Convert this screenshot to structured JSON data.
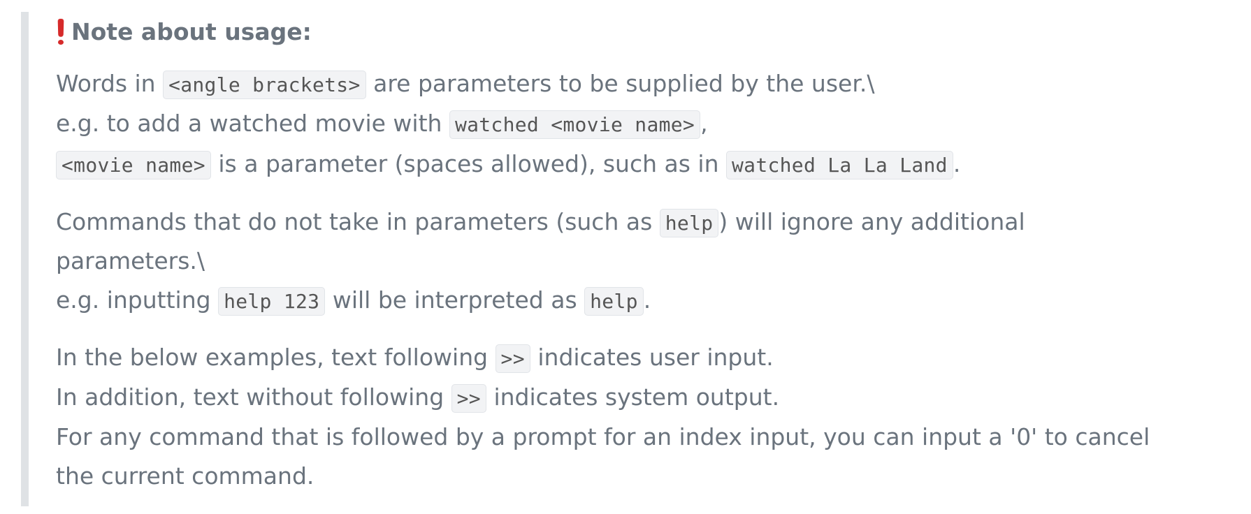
{
  "heading": "Note about usage:",
  "p1": {
    "l1_a": "Words in ",
    "l1_code": "<angle brackets>",
    "l1_b": " are parameters to be supplied by the user.\\",
    "l2_a": "e.g. to add a watched movie with ",
    "l2_code": "watched <movie name>",
    "l2_b": ",",
    "l3_code1": "<movie name>",
    "l3_a": " is a parameter (spaces allowed), such as in ",
    "l3_code2": "watched La La Land",
    "l3_b": "."
  },
  "p2": {
    "l1_a": "Commands that do not take in parameters (such as ",
    "l1_code": "help",
    "l1_b": ") will ignore any additional",
    "l2": "parameters.\\",
    "l3_a": "e.g. inputting ",
    "l3_code1": "help 123",
    "l3_b": " will be interpreted as ",
    "l3_code2": "help",
    "l3_c": "."
  },
  "p3": {
    "l1_a": "In the below examples, text following ",
    "l1_code": ">>",
    "l1_b": " indicates user input.",
    "l2_a": "In addition, text without following ",
    "l2_code": ">>",
    "l2_b": " indicates system output.",
    "l3": "For any command that is followed by a prompt for an index input, you can input a '0' to cancel",
    "l4": "the current command."
  },
  "colors": {
    "text": "#6a737d",
    "quote_border": "#dfe2e5",
    "code_bg": "#f2f3f5",
    "exclamation": "#d62a2a"
  },
  "icons": {
    "heading_icon": "exclamation-icon"
  }
}
